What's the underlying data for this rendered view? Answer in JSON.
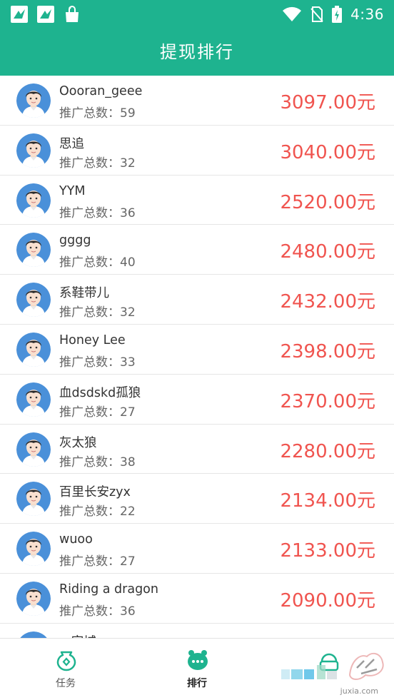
{
  "status_bar": {
    "time": "4:36",
    "icons_left": [
      "bird-app-icon",
      "bird-app-icon",
      "shopping-bag-icon"
    ],
    "icons_right": [
      "wifi-icon",
      "no-sim-icon",
      "battery-charging-icon"
    ]
  },
  "app_bar": {
    "title": "提现排行"
  },
  "colors": {
    "primary": "#1eb38f",
    "amount": "#f0544f"
  },
  "ranking": [
    {
      "name": "Oooran_geee",
      "count": "推广总数：59",
      "amount": "3097.00元"
    },
    {
      "name": "思追",
      "count": "推广总数：32",
      "amount": "3040.00元"
    },
    {
      "name": "YYM",
      "count": "推广总数：36",
      "amount": "2520.00元"
    },
    {
      "name": "gggg",
      "count": "推广总数：40",
      "amount": "2480.00元"
    },
    {
      "name": "系鞋带儿",
      "count": "推广总数：32",
      "amount": "2432.00元"
    },
    {
      "name": "Honey Lee",
      "count": "推广总数：33",
      "amount": "2398.00元"
    },
    {
      "name": "血dsdskd孤狼",
      "count": "推广总数：27",
      "amount": "2370.00元"
    },
    {
      "name": "灰太狼",
      "count": "推广总数：38",
      "amount": "2280.00元"
    },
    {
      "name": "百里长安zyx",
      "count": "推广总数：22",
      "amount": "2134.00元"
    },
    {
      "name": "wuoo",
      "count": "推广总数：27",
      "amount": "2133.00元"
    },
    {
      "name": "Riding a dragon",
      "count": "推广总数：36",
      "amount": "2090.00元"
    },
    {
      "name": "·· 宅城",
      "count": "",
      "amount": ""
    }
  ],
  "bottom_nav": [
    {
      "label": "任务",
      "icon": "task-icon",
      "active": false
    },
    {
      "label": "排行",
      "icon": "ranking-icon",
      "active": true
    },
    {
      "label": "",
      "icon": "profile-icon",
      "active": false
    }
  ],
  "watermark": {
    "text": "juxia.com"
  }
}
